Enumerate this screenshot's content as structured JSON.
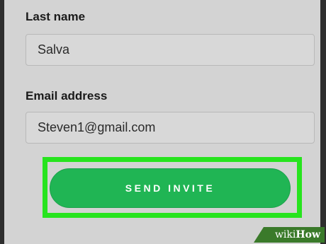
{
  "form": {
    "last_name": {
      "label": "Last name",
      "value": "Salva"
    },
    "email": {
      "label": "Email address",
      "value": "Steven1@gmail.com"
    }
  },
  "actions": {
    "send_invite_label": "SEND INVITE",
    "highlight_color": "#27e41e",
    "button_color": "#20b554"
  },
  "watermark": {
    "wiki": "wiki",
    "how": "How"
  }
}
